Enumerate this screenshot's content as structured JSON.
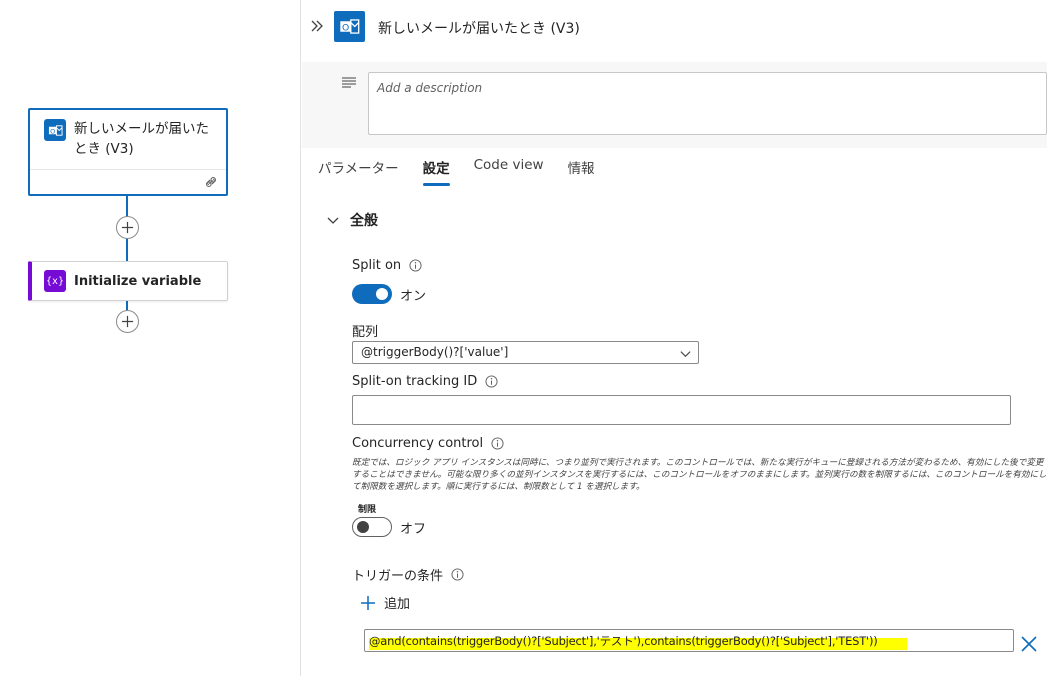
{
  "canvas": {
    "trigger_card": {
      "title": "新しいメールが届いたとき (V3)"
    },
    "variable_card": {
      "title": "Initialize variable",
      "icon_text": "{x}"
    }
  },
  "panel": {
    "title": "新しいメールが届いたとき (V3)",
    "description_placeholder": "Add a description",
    "tabs": [
      {
        "label": "パラメーター",
        "active": false
      },
      {
        "label": "設定",
        "active": true
      },
      {
        "label": "Code view",
        "active": false
      },
      {
        "label": "情報",
        "active": false
      }
    ],
    "section_title": "全般",
    "split_on": {
      "label": "Split on",
      "toggle_label": "オン",
      "enabled": true
    },
    "array": {
      "label": "配列",
      "value": "@triggerBody()?['value']"
    },
    "tracking_id": {
      "label": "Split-on tracking ID",
      "value": ""
    },
    "concurrency": {
      "label": "Concurrency control",
      "help": "既定では、ロジック アプリ インスタンスは同時に、つまり並列で実行されます。このコントロールでは、新たな実行がキューに登録される方法が変わるため、有効にした後で変更することはできません。可能な限り多くの並列インスタンスを実行するには、このコントロールをオフのままにします。並列実行の数を制限するには、このコントロールを有効にして制限数を選択します。順に実行するには、制限数として 1 を選択します。",
      "limit_label": "制限",
      "toggle_label": "オフ",
      "enabled": false
    },
    "trigger_conditions": {
      "label": "トリガーの条件",
      "add_label": "追加",
      "value": "@and(contains(triggerBody()?['Subject'],'テスト'),contains(triggerBody()?['Subject'],'TEST'))"
    }
  },
  "colors": {
    "accent": "#0f6cbd",
    "variable": "#770bd6",
    "highlight": "#ffff00"
  }
}
